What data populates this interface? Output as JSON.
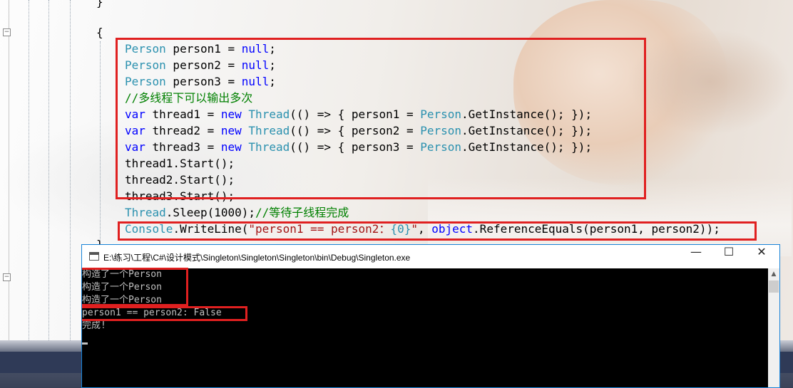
{
  "editor": {
    "top_brace_close": "}",
    "block_open_brace": "{",
    "block_close_brace": "}",
    "lines": [
      {
        "tokens": [
          {
            "t": "ty",
            "v": "Person"
          },
          {
            "t": "",
            "v": " person1 = "
          },
          {
            "t": "kw",
            "v": "null"
          },
          {
            "t": "",
            "v": ";"
          }
        ]
      },
      {
        "tokens": [
          {
            "t": "ty",
            "v": "Person"
          },
          {
            "t": "",
            "v": " person2 = "
          },
          {
            "t": "kw",
            "v": "null"
          },
          {
            "t": "",
            "v": ";"
          }
        ]
      },
      {
        "tokens": [
          {
            "t": "ty",
            "v": "Person"
          },
          {
            "t": "",
            "v": " person3 = "
          },
          {
            "t": "kw",
            "v": "null"
          },
          {
            "t": "",
            "v": ";"
          }
        ]
      },
      {
        "tokens": [
          {
            "t": "cm",
            "v": "//多线程下可以输出多次"
          }
        ]
      },
      {
        "tokens": [
          {
            "t": "kw",
            "v": "var"
          },
          {
            "t": "",
            "v": " thread1 = "
          },
          {
            "t": "kw",
            "v": "new"
          },
          {
            "t": "",
            "v": " "
          },
          {
            "t": "ty",
            "v": "Thread"
          },
          {
            "t": "",
            "v": "(() => { person1 = "
          },
          {
            "t": "ty",
            "v": "Person"
          },
          {
            "t": "",
            "v": ".GetInstance(); });"
          }
        ]
      },
      {
        "tokens": [
          {
            "t": "kw",
            "v": "var"
          },
          {
            "t": "",
            "v": " thread2 = "
          },
          {
            "t": "kw",
            "v": "new"
          },
          {
            "t": "",
            "v": " "
          },
          {
            "t": "ty",
            "v": "Thread"
          },
          {
            "t": "",
            "v": "(() => { person2 = "
          },
          {
            "t": "ty",
            "v": "Person"
          },
          {
            "t": "",
            "v": ".GetInstance(); });"
          }
        ]
      },
      {
        "tokens": [
          {
            "t": "kw",
            "v": "var"
          },
          {
            "t": "",
            "v": " thread3 = "
          },
          {
            "t": "kw",
            "v": "new"
          },
          {
            "t": "",
            "v": " "
          },
          {
            "t": "ty",
            "v": "Thread"
          },
          {
            "t": "",
            "v": "(() => { person3 = "
          },
          {
            "t": "ty",
            "v": "Person"
          },
          {
            "t": "",
            "v": ".GetInstance(); });"
          }
        ]
      },
      {
        "tokens": [
          {
            "t": "",
            "v": "thread1.Start();"
          }
        ]
      },
      {
        "tokens": [
          {
            "t": "",
            "v": "thread2.Start();"
          }
        ]
      },
      {
        "tokens": [
          {
            "t": "",
            "v": "thread3.Start();"
          }
        ]
      },
      {
        "tokens": [
          {
            "t": "ty",
            "v": "Thread"
          },
          {
            "t": "",
            "v": ".Sleep(1000);"
          },
          {
            "t": "cm",
            "v": "//等待子线程完成"
          }
        ]
      },
      {
        "tokens": [
          {
            "t": "ty",
            "v": "Console"
          },
          {
            "t": "",
            "v": ".WriteLine("
          },
          {
            "t": "st",
            "v": "\"person1 == person2："
          },
          {
            "t": "ty",
            "v": "{0}"
          },
          {
            "t": "st",
            "v": "\""
          },
          {
            "t": "",
            "v": ", "
          },
          {
            "t": "kw",
            "v": "object"
          },
          {
            "t": "",
            "v": ".ReferenceEquals(person1, person2));"
          }
        ]
      }
    ]
  },
  "console": {
    "title": "E:\\练习\\工程\\C#\\设计模式\\Singleton\\Singleton\\Singleton\\bin\\Debug\\Singleton.exe",
    "minimize": "—",
    "maximize": "☐",
    "close": "✕",
    "output": [
      "构造了一个Person",
      "构造了一个Person",
      "构造了一个Person",
      "person1 == person2: False",
      "完成!"
    ]
  },
  "colors": {
    "keyword": "#0000ff",
    "type": "#2b91af",
    "comment": "#008000",
    "string": "#a31515",
    "highlight_box": "#e02020"
  },
  "icons": [
    "collapse-minus-icon",
    "console-window-icon",
    "minimize-icon",
    "maximize-icon",
    "close-icon",
    "scroll-up-icon"
  ]
}
